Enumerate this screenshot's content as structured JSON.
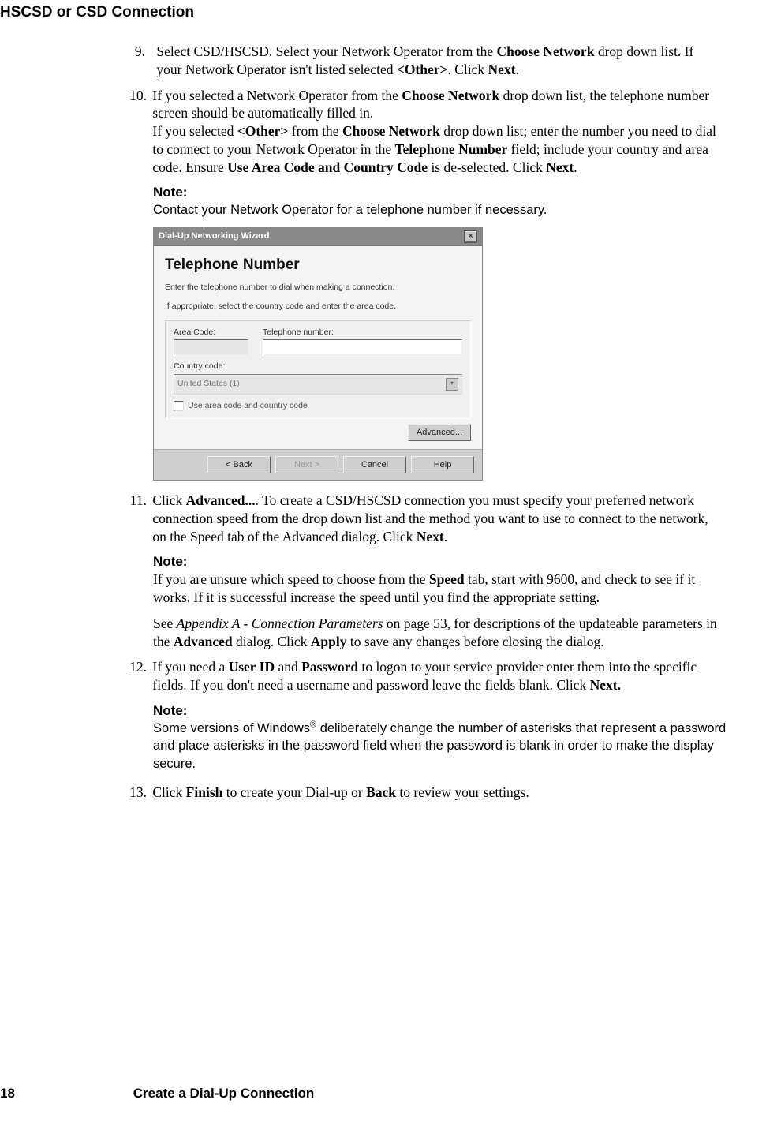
{
  "header": {
    "title": "HSCSD or CSD Connection"
  },
  "steps": {
    "s9": {
      "num": "9.",
      "text_before": "Select CSD/HSCSD. Select your Network Operator from the ",
      "bold1": "Choose Network",
      "text_mid1": " drop down list. If your Network Operator isn't listed selected ",
      "bold2": "<Other>",
      "text_mid2": ". Click ",
      "bold3": "Next",
      "text_end": "."
    },
    "s10": {
      "num": "10.",
      "p1_a": "If you selected a Network Operator from the ",
      "p1_b": "Choose Network",
      "p1_c": " drop down list, the telephone number screen should be automatically filled in.",
      "p2_a": "If you selected ",
      "p2_b": "<Other>",
      "p2_c": " from the ",
      "p2_d": "Choose Network",
      "p2_e": " drop down list; enter the number you need to dial to connect to your Network Operator in the ",
      "p2_f": "Telephone Number",
      "p2_g": " field; include your country and area code. Ensure ",
      "p2_h": "Use Area Code and Country Code",
      "p2_i": " is de-selected. Click ",
      "p2_j": "Next",
      "p2_k": "."
    },
    "note1": {
      "label": "Note:",
      "text": "Contact your Network Operator for a telephone number if necessary."
    },
    "dialog": {
      "title": "Dial-Up Networking Wizard",
      "heading": "Telephone Number",
      "sub1": "Enter the telephone number to dial when making a connection.",
      "sub2": "If appropriate, select the country code and enter the area code.",
      "area_label": "Area Code:",
      "tel_label": "Telephone number:",
      "country_label": "Country code:",
      "country_value": "United States (1)",
      "checkbox_label": "Use area code and country code",
      "advanced": "Advanced...",
      "back": "< Back",
      "next": "Next >",
      "cancel": "Cancel",
      "help": "Help"
    },
    "s11": {
      "num": "11.",
      "a": "Click ",
      "b": "Advanced...",
      "c": ". To create a CSD/HSCSD connection you must specify your preferred network connection speed from the drop down list and the method you want to use to connect to the network, on the Speed tab of the Advanced dialog. Click ",
      "d": "Next",
      "e": "."
    },
    "note2": {
      "label": "Note:",
      "a": "If you are unsure which speed to choose from the ",
      "b": "Speed",
      "c": " tab, start with 9600, and check to see if it works. If it is successful increase the speed until you find the appropriate setting."
    },
    "appendix": {
      "a": "See ",
      "b": "Appendix A - Connection Parameters",
      "c": " on page 53, for descriptions of the updateable parameters in the ",
      "d": "Advanced",
      "e": " dialog. Click ",
      "f": "Apply",
      "g": " to save any changes before closing the dialog."
    },
    "s12": {
      "num": "12.",
      "a": "If you need a ",
      "b": "User ID",
      "c": " and ",
      "d": "Password",
      "e": " to logon to your service provider enter them into the specific fields. If you don't need a username and password leave the fields blank. Click ",
      "f": "Next.",
      "g": ""
    },
    "note3": {
      "label": "Note:",
      "a": "Some versions of Windows",
      "reg": "®",
      "b": " deliberately change the number of asterisks that represent a password and place asterisks in the password field when the password is blank in order to make the display secure."
    },
    "s13": {
      "num": "13.",
      "a": "Click ",
      "b": "Finish",
      "c": " to create your Dial-up or ",
      "d": "Back",
      "e": " to review your settings."
    }
  },
  "footer": {
    "page": "18",
    "section": "Create a Dial-Up Connection"
  }
}
